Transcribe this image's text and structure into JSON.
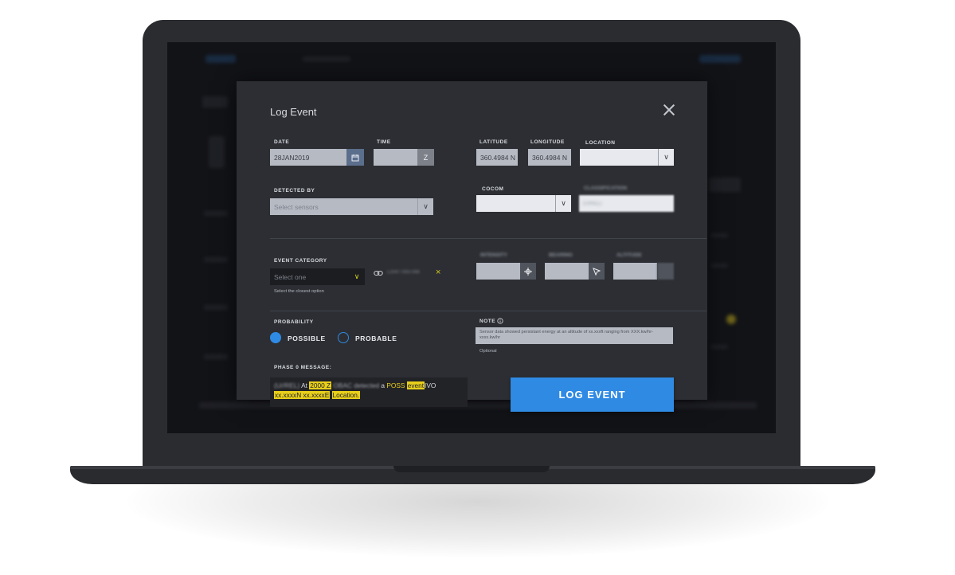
{
  "modal": {
    "title": "Log Event",
    "close_label": "×"
  },
  "labels": {
    "date": "DATE",
    "time": "TIME",
    "latitude": "LATITUDE",
    "longitude": "LONGITUDE",
    "location": "LOCATION",
    "detected_by": "DETECTED BY",
    "cocom": "COCOM",
    "event_category": "EVENT CATEGORY",
    "probability": "PROBABILITY",
    "note": "NOTE",
    "phase_message": "PHASE 0 MESSAGE:"
  },
  "fields": {
    "date_value": "28JAN2019",
    "time_value": "",
    "time_suffix": "Z",
    "latitude_value": "360.4984 N",
    "longitude_value": "360.4984 N",
    "location_value": "",
    "detected_by_placeholder": "Select sensors",
    "cocom_value": "",
    "classification_value": "(U//REL)",
    "event_category_placeholder": "Select one",
    "event_category_hint": "Select the closest option",
    "linked_item": "L2047-093-048",
    "note_text": "Sensor data showed persistant energy at an altitude of xx.xxxft ranging from XXX.kw/hr-xxxx.kw/hr",
    "note_hint": "Optional"
  },
  "blurred_labels": {
    "classification": "CLASSIFICATION",
    "intensity": "INTENSITY",
    "bearing": "BEARING",
    "altitude": "ALTITUDE"
  },
  "probability": {
    "options": [
      "POSSIBLE",
      "PROBABLE"
    ],
    "selected": "POSSIBLE"
  },
  "phase_message": {
    "prefix": "(U//REL)",
    "at": "At",
    "time": "2000 Z",
    "source": "OBAC detected",
    "a": "a",
    "poss": "POSS",
    "event": "event",
    "ivo": "IVO",
    "coords": "xx.xxxxN xx.xxxxE",
    "location": "Location."
  },
  "actions": {
    "log_event": "LOG EVENT"
  },
  "colors": {
    "accent": "#2f8ae4",
    "highlight": "#e8cf1a",
    "modal_bg": "#2c2e33"
  }
}
